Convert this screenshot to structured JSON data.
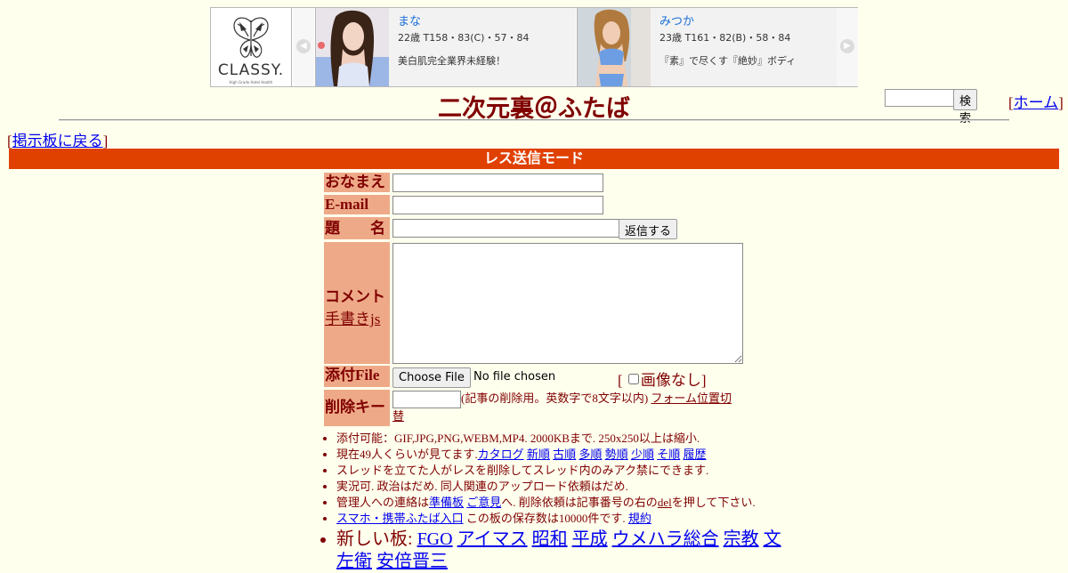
{
  "ad": {
    "brand": "CLASSY.",
    "tagline": "High Grade Hotel Health",
    "cards": [
      {
        "name": "まな",
        "stats": "22歳 T158・83(C)・57・84",
        "desc": "美白肌完全業界未経験！"
      },
      {
        "name": "みつか",
        "stats": "23歳 T161・82(B)・58・84",
        "desc": "『素』で尽くす『絶妙』ボディ"
      }
    ]
  },
  "header": {
    "title": "二次元裏＠ふたば",
    "search_button": "検索",
    "home_link": "ホーム",
    "back_link": "掲示板に戻る"
  },
  "mode_bar": "レス送信モード",
  "form": {
    "name_label": "おなまえ",
    "email_label": "E-mail",
    "subject_label": "題　　名",
    "submit_button": "返信する",
    "comment_label": "コメント",
    "handwrite_link": "手書きjs",
    "file_label": "添付File",
    "file_button": "Choose File",
    "file_status": "No file chosen",
    "no_image_label": "画像なし",
    "delkey_label": "削除キー",
    "delkey_note": "(記事の削除用。英数字で8文字以内)",
    "form_position_link": "フォーム位置切替"
  },
  "rules": {
    "r1": "添付可能：GIF,JPG,PNG,WEBM,MP4. 2000KBまで. 250x250以上は縮小.",
    "r2_prefix": "現在49人くらいが見てます.",
    "r2_links": [
      "カタログ",
      "新順",
      "古順",
      "多順",
      "勢順",
      "少順",
      "そ順",
      "履歴"
    ],
    "r3": "スレッドを立てた人がレスを削除してスレッド内のみアク禁にできます.",
    "r4": "実況可. 政治はだめ. 同人関連のアップロード依頼はだめ.",
    "r5_a": "管理人への連絡は",
    "r5_link1": "準備板",
    "r5_link2": "ご意見",
    "r5_b": "へ. 削除依頼は記事番号の右の",
    "r5_link3": "del",
    "r5_c": "を押して下さい.",
    "r6_link": "スマホ・携帯ふたば入口",
    "r6_text": " この板の保存数は10000件です.",
    "r6_link2": "規約",
    "new_boards_label": "新しい板:",
    "new_boards": [
      "FGO",
      "アイマス",
      "昭和",
      "平成",
      "ウメハラ総合",
      "宗教",
      "文左衛",
      "安倍晋三"
    ]
  }
}
